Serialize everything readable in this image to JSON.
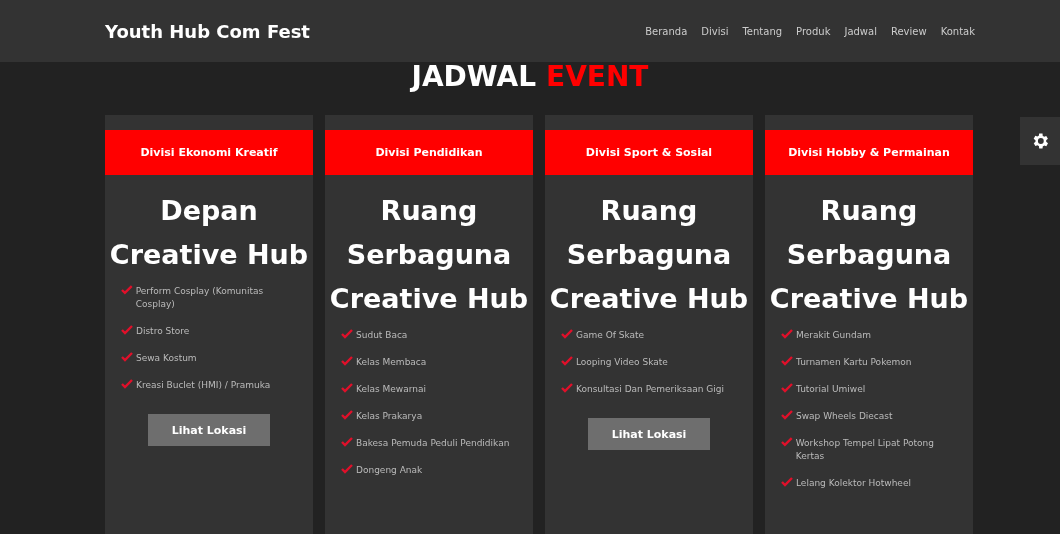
{
  "navbar": {
    "brand": "Youth Hub Com Fest",
    "links": [
      "Beranda",
      "Divisi",
      "Tentang",
      "Produk",
      "Jadwal",
      "Review",
      "Kontak"
    ]
  },
  "heading": {
    "text": "JADWAL",
    "accent": "EVENT"
  },
  "cards": [
    {
      "division": "Divisi Ekonomi Kreatif",
      "location": "Depan Creative Hub",
      "items": [
        "Perform Cosplay (Komunitas Cosplay)",
        "Distro Store",
        "Sewa Kostum",
        "Kreasi Buclet (HMI) / Pramuka"
      ],
      "button": "Lihat Lokasi"
    },
    {
      "division": "Divisi Pendidikan",
      "location": "Ruang Serbaguna Creative Hub",
      "items": [
        "Sudut Baca",
        "Kelas Membaca",
        "Kelas Mewarnai",
        "Kelas Prakarya",
        "Bakesa Pemuda Peduli Pendidikan",
        "Dongeng Anak"
      ]
    },
    {
      "division": "Divisi Sport & Sosial",
      "location": "Ruang Serbaguna Creative Hub",
      "items": [
        "Game Of Skate",
        "Looping Video Skate",
        "Konsultasi Dan Pemeriksaan Gigi"
      ],
      "button": "Lihat Lokasi"
    },
    {
      "division": "Divisi Hobby & Permainan",
      "location": "Ruang Serbaguna Creative Hub",
      "items": [
        "Merakit Gundam",
        "Turnamen Kartu Pokemon",
        "Tutorial Umiwel",
        "Swap Wheels Diecast",
        "Workshop Tempel Lipat Potong Kertas",
        "Lelang Kolektor Hotwheel"
      ]
    }
  ]
}
